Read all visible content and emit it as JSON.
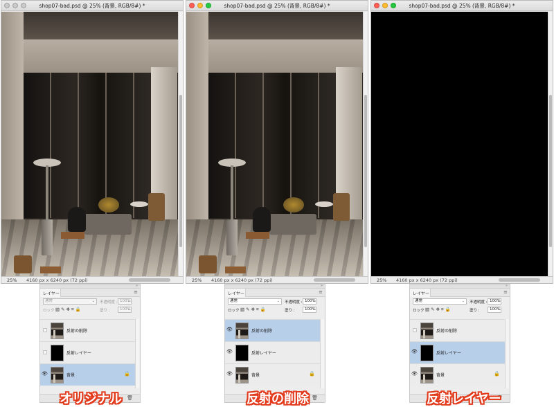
{
  "windows": [
    {
      "title": "shop07-bad.psd @ 25% (背景, RGB/8#) *",
      "zoom": "25%",
      "dims": "4160 px x 6240 px (72 ppi)",
      "canvas": "photo",
      "traffic_lights": [
        "#c9c9c9",
        "#c9c9c9",
        "#c9c9c9"
      ]
    },
    {
      "title": "shop07-bad.psd @ 25% (背景, RGB/8#) *",
      "zoom": "25%",
      "dims": "4160 px x 6240 px (72 ppi)",
      "canvas": "photo",
      "traffic_lights": [
        "#fe5f57",
        "#febc2e",
        "#28c840"
      ]
    },
    {
      "title": "shop07-bad.psd @ 25% (背景, RGB/8#) *",
      "zoom": "25%",
      "dims": "4160 px x 6240 px (72 ppi)",
      "canvas": "black",
      "traffic_lights": [
        "#fe5f57",
        "#febc2e",
        "#28c840"
      ]
    }
  ],
  "panels": [
    {
      "tab": "レイヤー",
      "blend_mode": "通常",
      "opacity_label": "不透明度 :",
      "opacity": "100%",
      "lock_label": "ロック :",
      "fill_label": "塗り :",
      "fill": "100%",
      "controls_dimmed": true,
      "layers": [
        {
          "name": "反射の削除",
          "visible": false,
          "selected": false,
          "thumb": "img",
          "locked": false
        },
        {
          "name": "反射レイヤー",
          "visible": false,
          "selected": false,
          "thumb": "blk",
          "locked": false
        },
        {
          "name": "背景",
          "visible": true,
          "selected": true,
          "thumb": "img",
          "locked": true
        }
      ]
    },
    {
      "tab": "レイヤー",
      "blend_mode": "通常",
      "opacity_label": "不透明度 :",
      "opacity": "100%",
      "lock_label": "ロック :",
      "fill_label": "塗り :",
      "fill": "100%",
      "controls_dimmed": false,
      "layers": [
        {
          "name": "反射の削除",
          "visible": true,
          "selected": true,
          "thumb": "img",
          "locked": false
        },
        {
          "name": "反射レイヤー",
          "visible": true,
          "selected": false,
          "thumb": "blk",
          "locked": false
        },
        {
          "name": "背景",
          "visible": true,
          "selected": false,
          "thumb": "img",
          "locked": true
        }
      ]
    },
    {
      "tab": "レイヤー",
      "blend_mode": "通常",
      "opacity_label": "不透明度 :",
      "opacity": "100%",
      "lock_label": "ロック :",
      "fill_label": "塗り :",
      "fill": "100%",
      "controls_dimmed": false,
      "layers": [
        {
          "name": "反射の削除",
          "visible": false,
          "selected": false,
          "thumb": "img",
          "locked": false
        },
        {
          "name": "反射レイヤー",
          "visible": true,
          "selected": true,
          "thumb": "blk",
          "locked": false
        },
        {
          "name": "背景",
          "visible": true,
          "selected": false,
          "thumb": "img",
          "locked": true
        }
      ]
    }
  ],
  "captions": [
    "オリジナル",
    "反射の削除",
    "反射レイヤー"
  ],
  "colors": {
    "selection": "#b8cfea",
    "caption_text": "#ffffff",
    "caption_outline": "#e33a1c"
  },
  "icons": {
    "eye": "eye-icon",
    "lock": "lock-icon",
    "trash": "trash-icon",
    "menu": "panel-menu-icon"
  }
}
